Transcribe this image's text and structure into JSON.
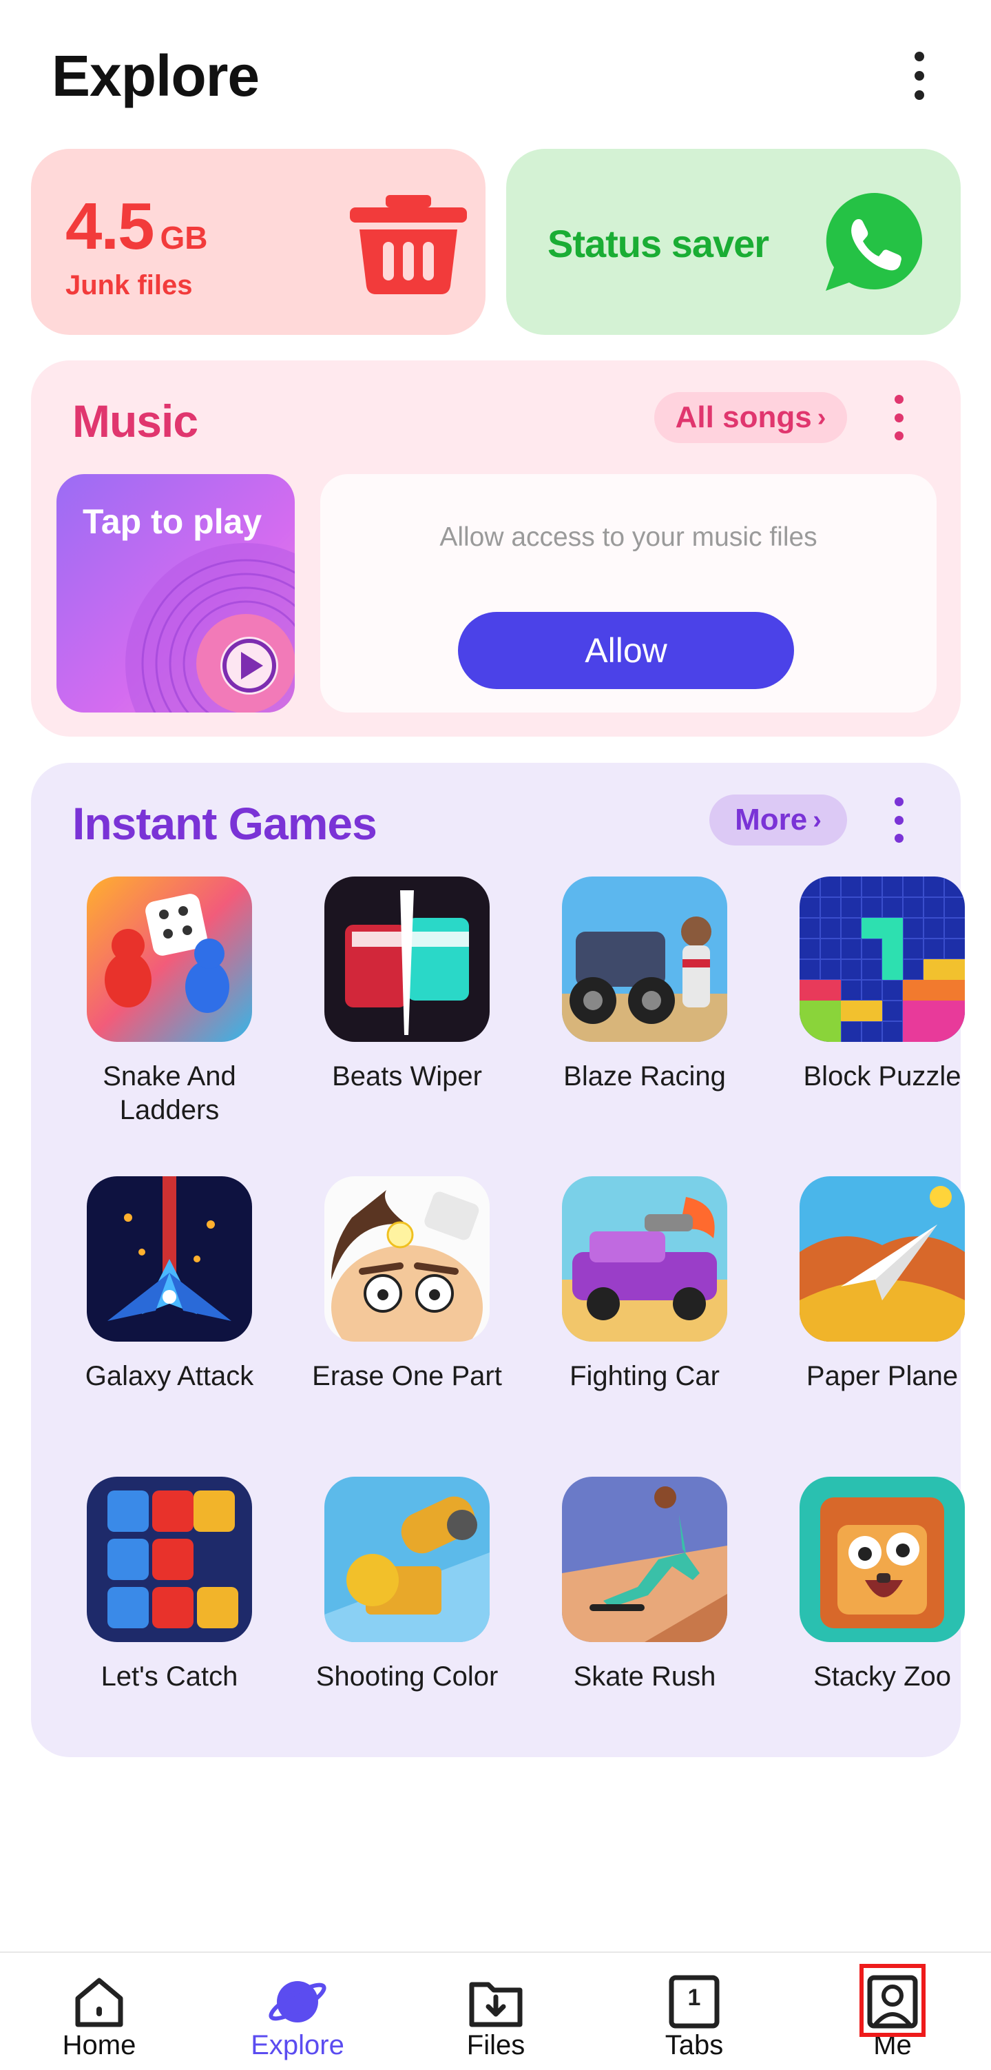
{
  "header": {
    "title": "Explore",
    "menu_icon": "more-vertical-icon"
  },
  "junk": {
    "size_value": "4.5",
    "size_unit": "GB",
    "label": "Junk files",
    "icon": "trash-icon",
    "color": "#f23b3b"
  },
  "status_saver": {
    "label": "Status saver",
    "icon": "whatsapp-icon",
    "color": "#1aad34"
  },
  "music": {
    "title": "Music",
    "all_songs": "All songs",
    "tap_to_play": "Tap to play",
    "access_text": "Allow access to your music files",
    "allow_button": "Allow",
    "accent": "#e0366e",
    "button_color": "#4b42e8"
  },
  "games": {
    "title": "Instant Games",
    "more": "More",
    "accent": "#7a33d6",
    "items": [
      {
        "name": "Snake And Ladders",
        "icon": "snake-and-ladders-icon"
      },
      {
        "name": "Beats Wiper",
        "icon": "beats-wiper-icon"
      },
      {
        "name": "Blaze Racing",
        "icon": "blaze-racing-icon"
      },
      {
        "name": "Block Puzzle",
        "icon": "block-puzzle-icon"
      },
      {
        "name": "Galaxy Attack",
        "icon": "galaxy-attack-icon"
      },
      {
        "name": "Erase One Part",
        "icon": "erase-one-part-icon"
      },
      {
        "name": "Fighting Car",
        "icon": "fighting-car-icon"
      },
      {
        "name": "Paper Plane",
        "icon": "paper-plane-icon"
      },
      {
        "name": "Let's Catch",
        "icon": "lets-catch-icon"
      },
      {
        "name": "Shooting Color",
        "icon": "shooting-color-icon"
      },
      {
        "name": "Skate Rush",
        "icon": "skate-rush-icon"
      },
      {
        "name": "Stacky Zoo",
        "icon": "stacky-zoo-icon"
      }
    ]
  },
  "nav": {
    "active": "Explore",
    "items": [
      {
        "label": "Home",
        "icon": "home-icon"
      },
      {
        "label": "Explore",
        "icon": "planet-icon"
      },
      {
        "label": "Files",
        "icon": "download-folder-icon"
      },
      {
        "label": "Tabs",
        "icon": "tabs-icon",
        "badge": "1"
      },
      {
        "label": "Me",
        "icon": "profile-icon"
      }
    ],
    "active_color": "#5b4cf0"
  }
}
